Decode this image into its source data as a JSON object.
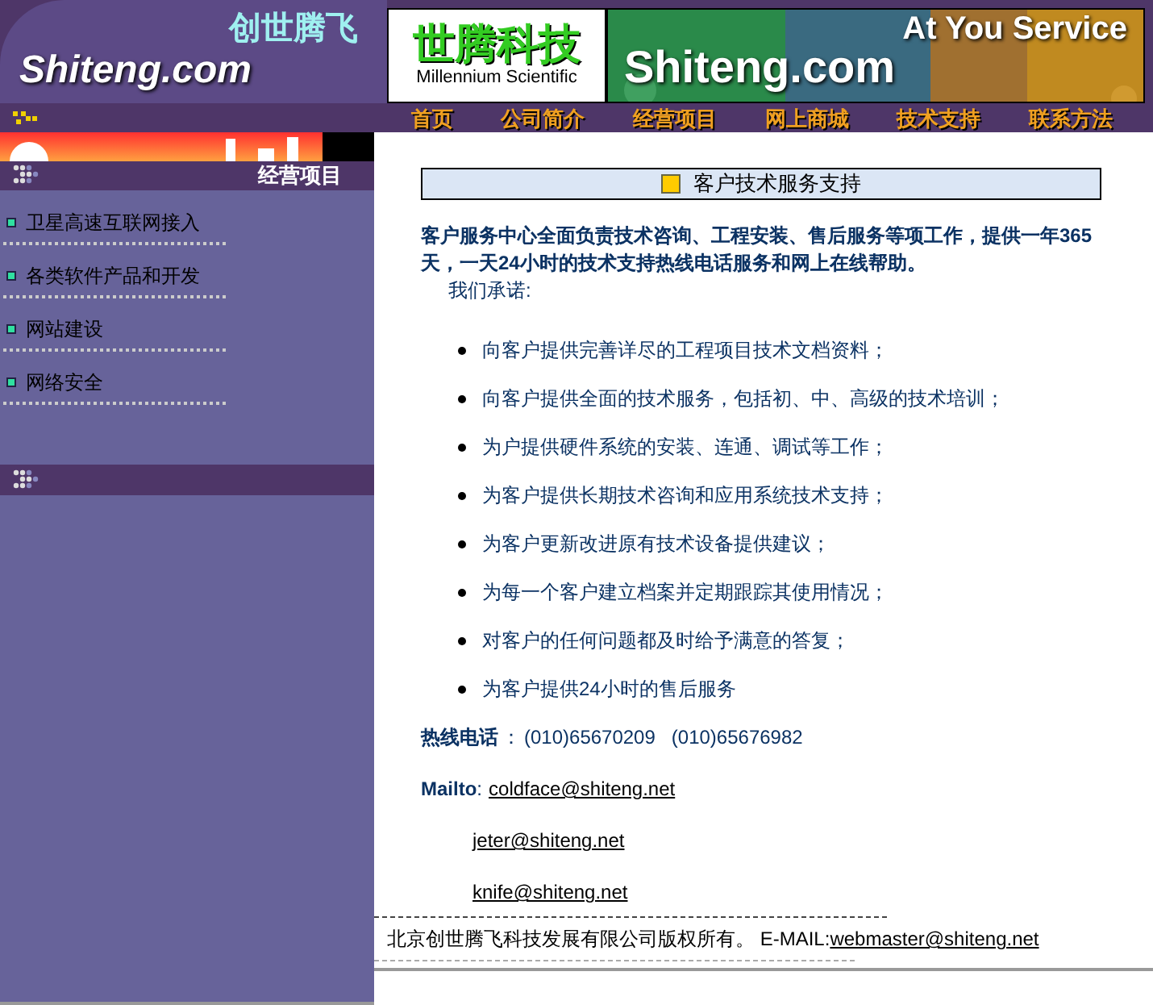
{
  "header": {
    "logo_cn": "创世腾飞",
    "logo": "Shiteng.com",
    "brand_cn": "世腾科技",
    "brand_en": "Millennium Scientific",
    "banner_slogan": "At You Service",
    "banner_logo": "Shiteng.com"
  },
  "nav": [
    {
      "label": "首页"
    },
    {
      "label": "公司简介"
    },
    {
      "label": "经营项目"
    },
    {
      "label": "网上商城"
    },
    {
      "label": "技术支持"
    },
    {
      "label": "联系方法"
    }
  ],
  "sidebar": {
    "title": "经营项目",
    "items": [
      {
        "label": "卫星高速互联网接入"
      },
      {
        "label": "各类软件产品和开发"
      },
      {
        "label": "网站建设"
      },
      {
        "label": "网络安全"
      }
    ]
  },
  "content": {
    "title": "客户技术服务支持",
    "intro": "客户服务中心全面负责技术咨询、工程安装、售后服务等项工作，提供一年365天，一天24小时的技术支持热线电话服务和网上在线帮助。",
    "promise": "我们承诺:",
    "items": [
      "向客户提供完善详尽的工程项目技术文档资料；",
      "向客户提供全面的技术服务，包括初、中、高级的技术培训；",
      "为户提供硬件系统的安装、连通、调试等工作；",
      "为客户提供长期技术咨询和应用系统技术支持；",
      "为客户更新改进原有技术设备提供建议；",
      "为每一个客户建立档案并定期跟踪其使用情况；",
      "对客户的任何问题都及时给予满意的答复；",
      "为客户提供24小时的售后服务"
    ],
    "hotline_label": "热线电话",
    "hotline_separator": "：",
    "hotline": "(010)65670209   (010)65676982",
    "mailto_label": "Mailto",
    "mailto_separator": ":",
    "emails": [
      "coldface@shiteng.net",
      "jeter@shiteng.net",
      "knife@shiteng.net"
    ]
  },
  "footer": {
    "copyright": "北京创世腾飞科技发展有限公司版权所有。 E-MAIL:",
    "email": "webmaster@shiteng.net"
  }
}
